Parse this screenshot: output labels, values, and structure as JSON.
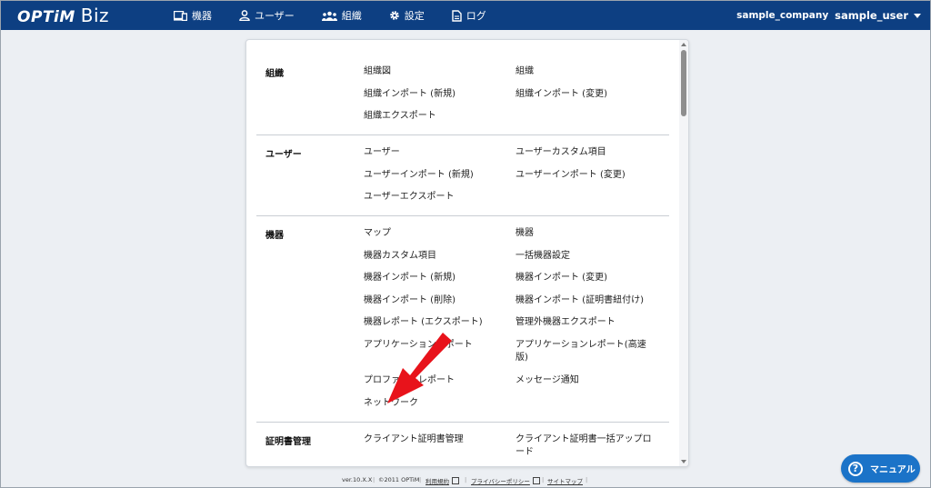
{
  "header": {
    "logo_main": "OPTiM",
    "logo_sub": "Biz",
    "nav": [
      {
        "label": "機器",
        "icon": "device-icon"
      },
      {
        "label": "ユーザー",
        "icon": "user-icon"
      },
      {
        "label": "組織",
        "icon": "organization-icon"
      },
      {
        "label": "設定",
        "icon": "gear-icon"
      },
      {
        "label": "ログ",
        "icon": "document-icon"
      }
    ],
    "company": "sample_company",
    "user": "sample_user"
  },
  "sections": [
    {
      "title": "組織",
      "links": [
        "組織図",
        "組織",
        "組織インポート (新規)",
        "組織インポート (変更)",
        "組織エクスポート"
      ]
    },
    {
      "title": "ユーザー",
      "links": [
        "ユーザー",
        "ユーザーカスタム項目",
        "ユーザーインポート (新規)",
        "ユーザーインポート (変更)",
        "ユーザーエクスポート"
      ]
    },
    {
      "title": "機器",
      "links": [
        "マップ",
        "機器",
        "機器カスタム項目",
        "一括機器設定",
        "機器インポート (新規)",
        "機器インポート (変更)",
        "機器インポート (削除)",
        "機器インポート (証明書紐付け)",
        "機器レポート (エクスポート)",
        "管理外機器エクスポート",
        "アプリケーションレポート",
        "アプリケーションレポート(高速版)",
        "プロファイルレポート",
        "メッセージ通知",
        "ネットワーク"
      ]
    },
    {
      "title": "証明書管理",
      "links": [
        "クライアント証明書管理",
        "クライアント証明書一括アップロード"
      ]
    }
  ],
  "footer": {
    "version": "ver.10.X.X",
    "copyright": "©2011 OPTiM",
    "terms": "利用規約",
    "privacy": "プライバシーポリシー",
    "sitemap": "サイトマップ"
  },
  "manual_button": {
    "label": "マニュアル",
    "icon": "question-icon"
  },
  "colors": {
    "header_bg": "#0d3f82",
    "background": "#eceff3",
    "manual_button": "#1b73c8",
    "arrow": "#e8131b"
  }
}
